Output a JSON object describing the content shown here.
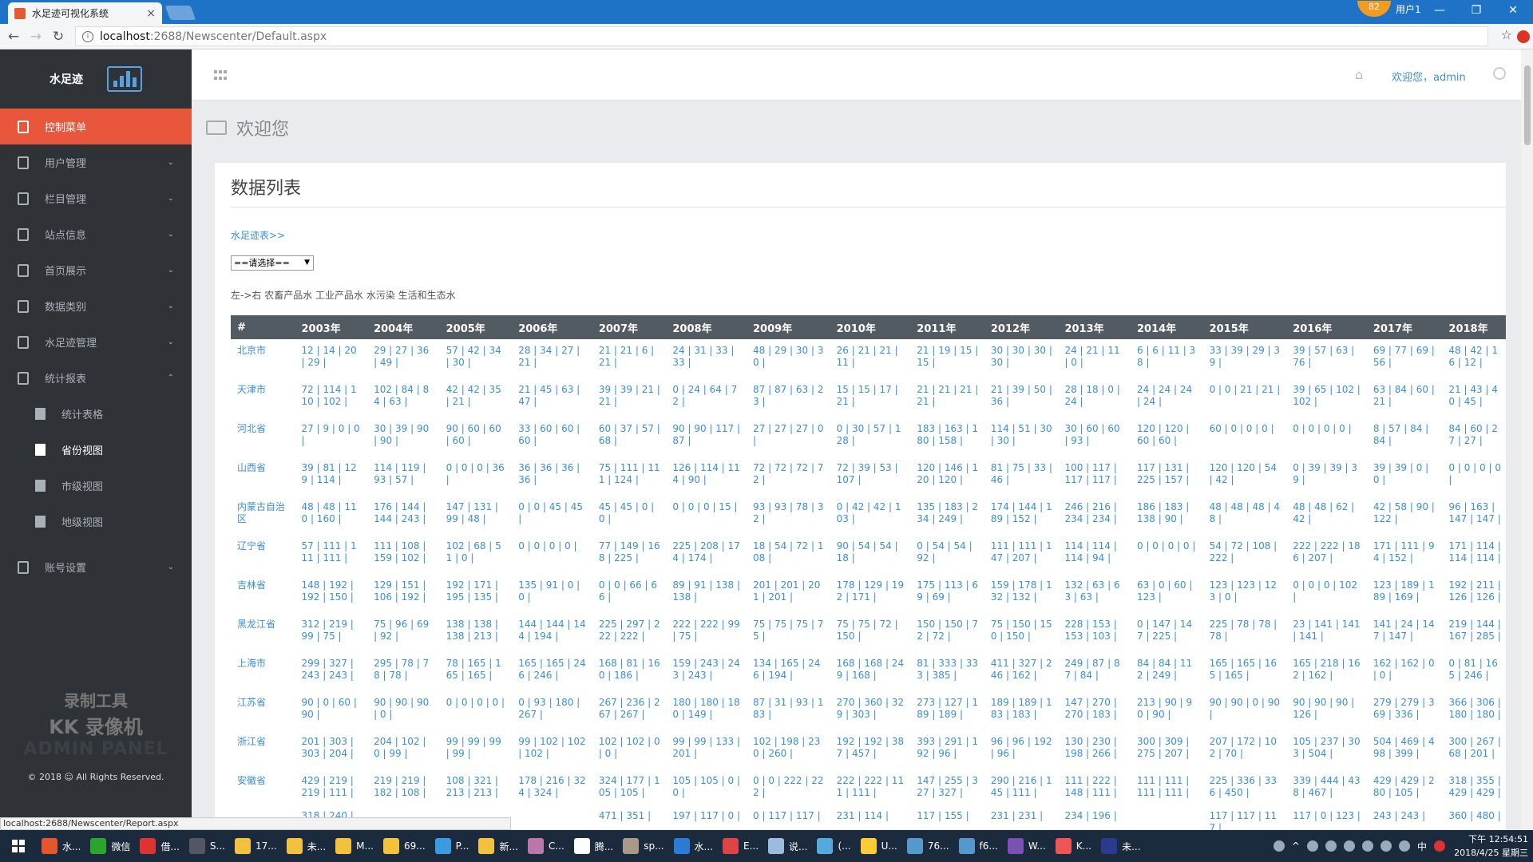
{
  "browser": {
    "tab_title": "水足迹可视化系统",
    "tab_close": "×",
    "profile_badge": "82",
    "profile_name": "用户1",
    "minimize": "—",
    "restore": "❐",
    "close": "✕",
    "url_host": "localhost",
    "url_path": ":2688/Newscenter/Default.aspx",
    "status_url": "localhost:2688/Newscenter/Report.aspx"
  },
  "sidebar": {
    "brand": "水足迹",
    "items": [
      {
        "label": "控制菜单"
      },
      {
        "label": "用户管理"
      },
      {
        "label": "栏目管理"
      },
      {
        "label": "站点信息"
      },
      {
        "label": "首页展示"
      },
      {
        "label": "数据类别"
      },
      {
        "label": "水足迹管理"
      },
      {
        "label": "统计报表"
      }
    ],
    "subitems": [
      {
        "label": "统计表格"
      },
      {
        "label": "省份视图"
      },
      {
        "label": "市级视图"
      },
      {
        "label": "地级视图"
      }
    ],
    "account": "账号设置",
    "watermark1": "录制工具",
    "watermark2": "KK 录像机",
    "watermark3": "ADMIN PANEL",
    "copyright": "© 2018 ☺ All Rights Reserved."
  },
  "topbar": {
    "welcome": "欢迎您，admin"
  },
  "page": {
    "heading": "欢迎您",
    "panel_title": "数据列表",
    "breadcrumb": "水足迹表>>",
    "select_value": "==请选择==",
    "legend": "左->右 农畜产品水 工业产品水 水污染 生活和生态水"
  },
  "table": {
    "headers": [
      "#",
      "2003年",
      "2004年",
      "2005年",
      "2006年",
      "2007年",
      "2008年",
      "2009年",
      "2010年",
      "2011年",
      "2012年",
      "2013年",
      "2014年",
      "2015年",
      "2016年",
      "2017年",
      "2018年"
    ],
    "rows": [
      [
        "北京市",
        "12 | 14 | 20 | 29 |",
        "29 | 27 | 36 | 49 |",
        "57 | 42 | 34 | 30 |",
        "28 | 34 | 27 | 21 |",
        "21 | 21 | 6 | 21 |",
        "24 | 31 | 33 | 33 |",
        "48 | 29 | 30 | 30 |",
        "26 | 21 | 21 | 11 |",
        "21 | 19 | 15 | 15 |",
        "30 | 30 | 30 | 30 |",
        "24 | 21 | 11 | 0 |",
        "6 | 6 | 11 | 38 |",
        "33 | 39 | 29 | 39 |",
        "39 | 57 | 63 | 76 |",
        "69 | 77 | 69 | 56 |",
        "48 | 42 | 16 | 12 |"
      ],
      [
        "天津市",
        "72 | 114 | 110 | 102 |",
        "102 | 84 | 84 | 63 |",
        "42 | 42 | 35 | 21 |",
        "21 | 45 | 63 | 47 |",
        "39 | 39 | 21 | 21 |",
        "0 | 24 | 64 | 72 |",
        "87 | 87 | 63 | 23 |",
        "15 | 15 | 17 | 21 |",
        "21 | 21 | 21 | 21 |",
        "21 | 39 | 50 | 36 |",
        "28 | 18 | 0 | 24 |",
        "24 | 24 | 24 | 24 |",
        "0 | 0 | 21 | 21 |",
        "39 | 65 | 102 | 102 |",
        "63 | 84 | 60 | 21 |",
        "21 | 43 | 40 | 45 |"
      ],
      [
        "河北省",
        "27 | 9 | 0 | 0 |",
        "30 | 39 | 90 | 90 |",
        "90 | 60 | 60 | 60 |",
        "33 | 60 | 60 | 60 |",
        "60 | 37 | 57 | 68 |",
        "90 | 90 | 117 | 87 |",
        "27 | 27 | 27 | 0 |",
        "0 | 30 | 57 | 128 |",
        "183 | 163 | 180 | 158 |",
        "114 | 51 | 30 | 30 |",
        "30 | 60 | 60 | 93 |",
        "120 | 120 | 60 | 60 |",
        "60 | 0 | 0 | 0 |",
        "0 | 0 | 0 | 0 |",
        "8 | 57 | 84 | 84 |",
        "84 | 60 | 27 | 27 |"
      ],
      [
        "山西省",
        "39 | 81 | 129 | 114 |",
        "114 | 119 | 93 | 57 |",
        "0 | 0 | 0 | 36 |",
        "36 | 36 | 36 | 36 |",
        "75 | 111 | 111 | 124 |",
        "126 | 114 | 114 | 90 |",
        "72 | 72 | 72 | 72 |",
        "72 | 39 | 53 | 107 |",
        "120 | 146 | 120 | 120 |",
        "81 | 75 | 33 | 46 |",
        "100 | 117 | 117 | 117 |",
        "117 | 131 | 225 | 157 |",
        "120 | 120 | 54 | 42 |",
        "0 | 39 | 39 | 39 |",
        "39 | 39 | 0 | 0 |",
        "0 | 0 | 0 | 0 |"
      ],
      [
        "内蒙古自治区",
        "48 | 48 | 110 | 160 |",
        "176 | 144 | 144 | 243 |",
        "147 | 131 | 99 | 48 |",
        "0 | 0 | 45 | 45 |",
        "45 | 45 | 0 | 0 |",
        "0 | 0 | 0 | 15 |",
        "93 | 93 | 78 | 32 |",
        "0 | 42 | 42 | 103 |",
        "135 | 183 | 234 | 249 |",
        "174 | 144 | 189 | 152 |",
        "246 | 216 | 234 | 234 |",
        "186 | 183 | 138 | 90 |",
        "48 | 48 | 48 | 48 |",
        "48 | 48 | 62 | 42 |",
        "42 | 58 | 90 | 122 |",
        "96 | 163 | 147 | 147 |"
      ],
      [
        "辽宁省",
        "57 | 111 | 111 | 111 |",
        "111 | 108 | 159 | 102 |",
        "102 | 68 | 51 | 0 |",
        "0 | 0 | 0 | 0 |",
        "77 | 149 | 168 | 225 |",
        "225 | 208 | 174 | 174 |",
        "18 | 54 | 72 | 108 |",
        "90 | 54 | 54 | 18 |",
        "0 | 54 | 54 | 92 |",
        "111 | 111 | 147 | 207 |",
        "114 | 114 | 114 | 94 |",
        "0 | 0 | 0 | 0 |",
        "54 | 72 | 108 | 222 |",
        "222 | 222 | 186 | 207 |",
        "171 | 111 | 94 | 152 |",
        "171 | 114 | 114 | 114 |"
      ],
      [
        "吉林省",
        "148 | 192 | 192 | 150 |",
        "129 | 151 | 106 | 192 |",
        "192 | 171 | 195 | 135 |",
        "135 | 91 | 0 | 0 |",
        "0 | 0 | 66 | 66 |",
        "89 | 91 | 138 | 138 |",
        "201 | 201 | 201 | 201 |",
        "178 | 129 | 192 | 171 |",
        "175 | 113 | 69 | 69 |",
        "159 | 178 | 132 | 132 |",
        "132 | 63 | 63 | 63 |",
        "63 | 0 | 60 | 123 |",
        "123 | 123 | 123 | 0 |",
        "0 | 0 | 0 | 102 |",
        "123 | 189 | 189 | 169 |",
        "192 | 211 | 126 | 126 |"
      ],
      [
        "黑龙江省",
        "312 | 219 | 99 | 75 |",
        "75 | 96 | 69 | 92 |",
        "138 | 138 | 138 | 213 |",
        "144 | 144 | 144 | 194 |",
        "225 | 297 | 222 | 222 |",
        "222 | 222 | 99 | 75 |",
        "75 | 75 | 75 | 75 |",
        "75 | 75 | 72 | 150 |",
        "150 | 150 | 72 | 72 |",
        "75 | 150 | 150 | 150 |",
        "228 | 153 | 153 | 103 |",
        "0 | 147 | 147 | 225 |",
        "225 | 78 | 78 | 78 |",
        "23 | 141 | 141 | 141 |",
        "141 | 24 | 147 | 147 |",
        "219 | 144 | 167 | 285 |"
      ],
      [
        "上海市",
        "299 | 327 | 243 | 243 |",
        "295 | 78 | 78 | 78 |",
        "78 | 165 | 165 | 165 |",
        "165 | 165 | 246 | 246 |",
        "168 | 81 | 160 | 186 |",
        "159 | 243 | 243 | 243 |",
        "134 | 165 | 246 | 194 |",
        "168 | 168 | 249 | 168 |",
        "81 | 333 | 333 | 385 |",
        "411 | 327 | 246 | 162 |",
        "249 | 87 | 87 | 84 |",
        "84 | 84 | 112 | 249 |",
        "165 | 165 | 165 | 165 |",
        "165 | 218 | 162 | 162 |",
        "162 | 162 | 0 | 0 |",
        "0 | 81 | 165 | 246 |"
      ],
      [
        "江苏省",
        "90 | 0 | 60 | 90 |",
        "90 | 90 | 90 | 0 |",
        "0 | 0 | 0 | 0 |",
        "0 | 93 | 180 | 267 |",
        "267 | 236 | 267 | 267 |",
        "180 | 180 | 180 | 149 |",
        "87 | 31 | 93 | 183 |",
        "270 | 360 | 329 | 303 |",
        "273 | 127 | 189 | 189 |",
        "189 | 189 | 183 | 183 |",
        "147 | 270 | 270 | 183 |",
        "213 | 90 | 90 | 90 |",
        "90 | 90 | 0 | 90 |",
        "90 | 90 | 90 | 126 |",
        "279 | 279 | 369 | 336 |",
        "366 | 306 | 180 | 180 |"
      ],
      [
        "浙江省",
        "201 | 303 | 303 | 204 |",
        "204 | 102 | 0 | 99 |",
        "99 | 99 | 99 | 99 |",
        "99 | 102 | 102 | 102 |",
        "102 | 102 | 0 | 0 |",
        "99 | 99 | 133 | 201 |",
        "102 | 198 | 230 | 260 |",
        "192 | 192 | 387 | 457 |",
        "393 | 291 | 192 | 96 |",
        "96 | 96 | 192 | 96 |",
        "130 | 230 | 198 | 266 |",
        "300 | 309 | 275 | 207 |",
        "207 | 172 | 102 | 70 |",
        "105 | 237 | 303 | 504 |",
        "504 | 469 | 498 | 399 |",
        "300 | 267 | 68 | 201 |"
      ],
      [
        "安徽省",
        "429 | 219 | 219 | 111 |",
        "219 | 219 | 182 | 108 |",
        "108 | 321 | 213 | 213 |",
        "178 | 216 | 324 | 324 |",
        "324 | 177 | 105 | 105 |",
        "105 | 105 | 0 | 0 |",
        "0 | 0 | 222 | 222 |",
        "222 | 222 | 111 | 111 |",
        "147 | 255 | 327 | 327 |",
        "290 | 216 | 145 | 111 |",
        "111 | 222 | 148 | 111 |",
        "111 | 111 | 111 | 111 |",
        "225 | 336 | 336 | 450 |",
        "339 | 444 | 438 | 467 |",
        "429 | 429 | 280 | 105 |",
        "318 | 355 | 429 | 429 |"
      ],
      [
        "",
        "318 | 240 |",
        "",
        "",
        "",
        "471 | 351 |",
        "197 | 117 | 0 |",
        "0 | 117 | 117 |",
        "231 | 114 |",
        "117 | 155 |",
        "231 | 231 |",
        "234 | 196 |",
        "",
        "117 | 117 | 117 |",
        "117 | 0 | 123 |",
        "243 | 243 |",
        "360 | 480 |"
      ]
    ]
  },
  "taskbar": {
    "items": [
      {
        "label": "水...",
        "color": "#e4572e"
      },
      {
        "label": "微信",
        "color": "#2ca52c"
      },
      {
        "label": "借...",
        "color": "#d33"
      },
      {
        "label": "S...",
        "color": "#556"
      },
      {
        "label": "17...",
        "color": "#f3c23c"
      },
      {
        "label": "未...",
        "color": "#f3c23c"
      },
      {
        "label": "M...",
        "color": "#f3c23c"
      },
      {
        "label": "69...",
        "color": "#f3c23c"
      },
      {
        "label": "P...",
        "color": "#3a9be0"
      },
      {
        "label": "新...",
        "color": "#f3c23c"
      },
      {
        "label": "C...",
        "color": "#b7a"
      },
      {
        "label": "腾...",
        "color": "#fff"
      },
      {
        "label": "sp...",
        "color": "#a98"
      },
      {
        "label": "水...",
        "color": "#2b7cd3"
      },
      {
        "label": "E...",
        "color": "#d44"
      },
      {
        "label": "说...",
        "color": "#9bd"
      },
      {
        "label": "(...",
        "color": "#5ad"
      },
      {
        "label": "U...",
        "color": "#fc3"
      },
      {
        "label": "76...",
        "color": "#59c"
      },
      {
        "label": "f6...",
        "color": "#59c"
      },
      {
        "label": "W...",
        "color": "#7952b3"
      },
      {
        "label": "K...",
        "color": "#e55"
      },
      {
        "label": "未...",
        "color": "#2a3b8f"
      }
    ],
    "ime": "中",
    "time": "下午 12:54:51",
    "date": "2018/4/25 星期三"
  }
}
